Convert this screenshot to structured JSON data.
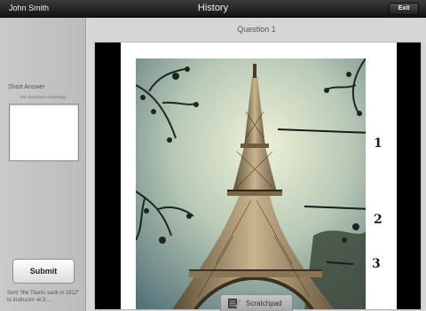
{
  "topbar": {
    "user_name": "John Smith",
    "title": "History",
    "exit_label": "Exit"
  },
  "left_panel": {
    "short_answer_label": "Short Answer",
    "char_remaining": "(44 characters remaining)",
    "answer_value": "",
    "submit_label": "Submit",
    "sent_status": "Sent \"the Titanic sank in 1912\" to instructor at 3:..."
  },
  "main": {
    "question_label": "Question 1",
    "image_markers": [
      "1",
      "2",
      "3"
    ],
    "scratchpad_label": "Scratchpad",
    "scratchpad_icon": "pencil-notepad-icon"
  }
}
